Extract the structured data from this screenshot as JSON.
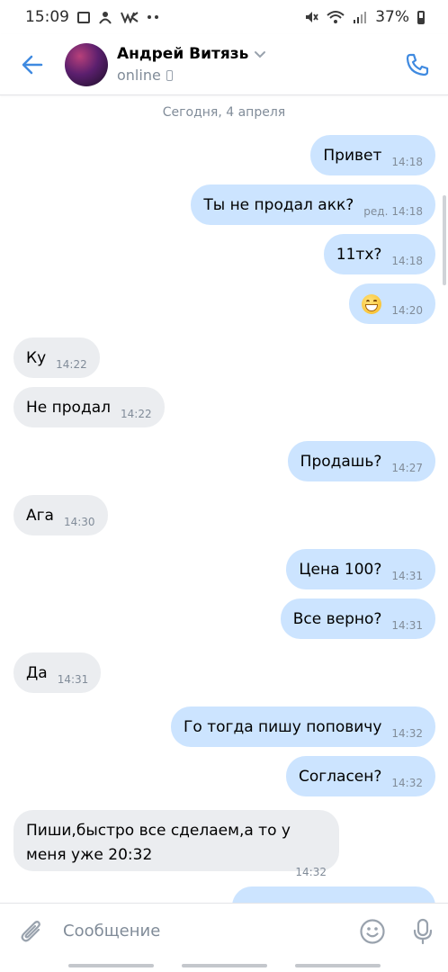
{
  "status_bar": {
    "time": "15:09",
    "battery": "37%",
    "icons": [
      "image-icon",
      "vk-app-icon",
      "vk-logo-icon",
      "more-dots-icon",
      "mute-icon",
      "wifi-icon",
      "signal-icon",
      "battery-icon"
    ]
  },
  "header": {
    "name": "Андрей Витязь",
    "status": "online"
  },
  "chat": {
    "date": "Сегодня, 4 апреля",
    "messages": [
      {
        "dir": "out",
        "text": "Привет",
        "time": "14:18"
      },
      {
        "dir": "out",
        "text": "Ты не продал акк?",
        "edited": "ред.",
        "time": "14:18"
      },
      {
        "dir": "out",
        "text": "11тх?",
        "time": "14:18"
      },
      {
        "dir": "out",
        "emoji": "grinning-face",
        "time": "14:20"
      },
      {
        "dir": "in",
        "text": "Ку",
        "time": "14:22"
      },
      {
        "dir": "in",
        "text": "Не продал",
        "time": "14:22"
      },
      {
        "dir": "out",
        "text": "Продашь?",
        "time": "14:27"
      },
      {
        "dir": "in",
        "text": "Ага",
        "time": "14:30"
      },
      {
        "dir": "out",
        "text": "Цена 100?",
        "time": "14:31"
      },
      {
        "dir": "out",
        "text": "Все верно?",
        "time": "14:31"
      },
      {
        "dir": "in",
        "text": "Да",
        "time": "14:31"
      },
      {
        "dir": "out",
        "text": "Го тогда пишу поповичу",
        "time": "14:32"
      },
      {
        "dir": "out",
        "text": "Согласен?",
        "time": "14:32"
      },
      {
        "dir": "in",
        "text": "Пиши,быстро все сделаем,а то у меня уже 20:32",
        "time": "14:32"
      }
    ]
  },
  "composer": {
    "placeholder": "Сообщение"
  },
  "colors": {
    "accent": "#3f8ae0",
    "outgoing_bubble": "#cce4ff",
    "incoming_bubble": "#ebedf0",
    "secondary_text": "#818c99"
  }
}
